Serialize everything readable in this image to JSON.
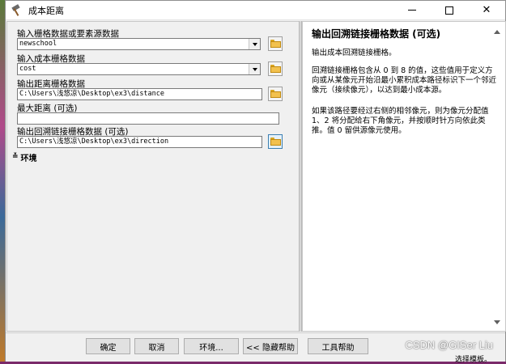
{
  "window": {
    "title": "成本距离"
  },
  "form": {
    "fields": [
      {
        "label": "输入栅格数据或要素源数据",
        "value": "newschool",
        "type": "combo"
      },
      {
        "label": "输入成本栅格数据",
        "value": "cost",
        "type": "combo"
      },
      {
        "label": "输出距离栅格数据",
        "value": "C:\\Users\\浅悠凉\\Desktop\\ex3\\distance",
        "type": "text"
      },
      {
        "label": "最大距离 (可选)",
        "value": "",
        "type": "text"
      },
      {
        "label": "输出回溯链接栅格数据 (可选)",
        "value": "C:\\Users\\浅悠凉\\Desktop\\ex3\\direction",
        "type": "text"
      }
    ],
    "environment_label": "环境"
  },
  "help": {
    "title": "输出回溯链接栅格数据 (可选)",
    "paragraphs": [
      "输出成本回溯链接栅格。",
      "回溯链接栅格包含从 0 到 8 的值，这些值用于定义方向或从某像元开始沿最小累积成本路径标识下一个邻近像元（接续像元），以达到最小成本源。",
      "如果该路径要经过右侧的相邻像元，则为像元分配值 1、2 将分配给右下角像元，并按顺时针方向依此类推。值 0 留供源像元使用。"
    ]
  },
  "buttons": {
    "ok": "确定",
    "cancel": "取消",
    "env": "环境...",
    "hide_help": "<< 隐藏帮助",
    "tool_help": "工具帮助"
  },
  "watermark": "CSDN @GISer Liu",
  "corner_text": "选择模板。"
}
